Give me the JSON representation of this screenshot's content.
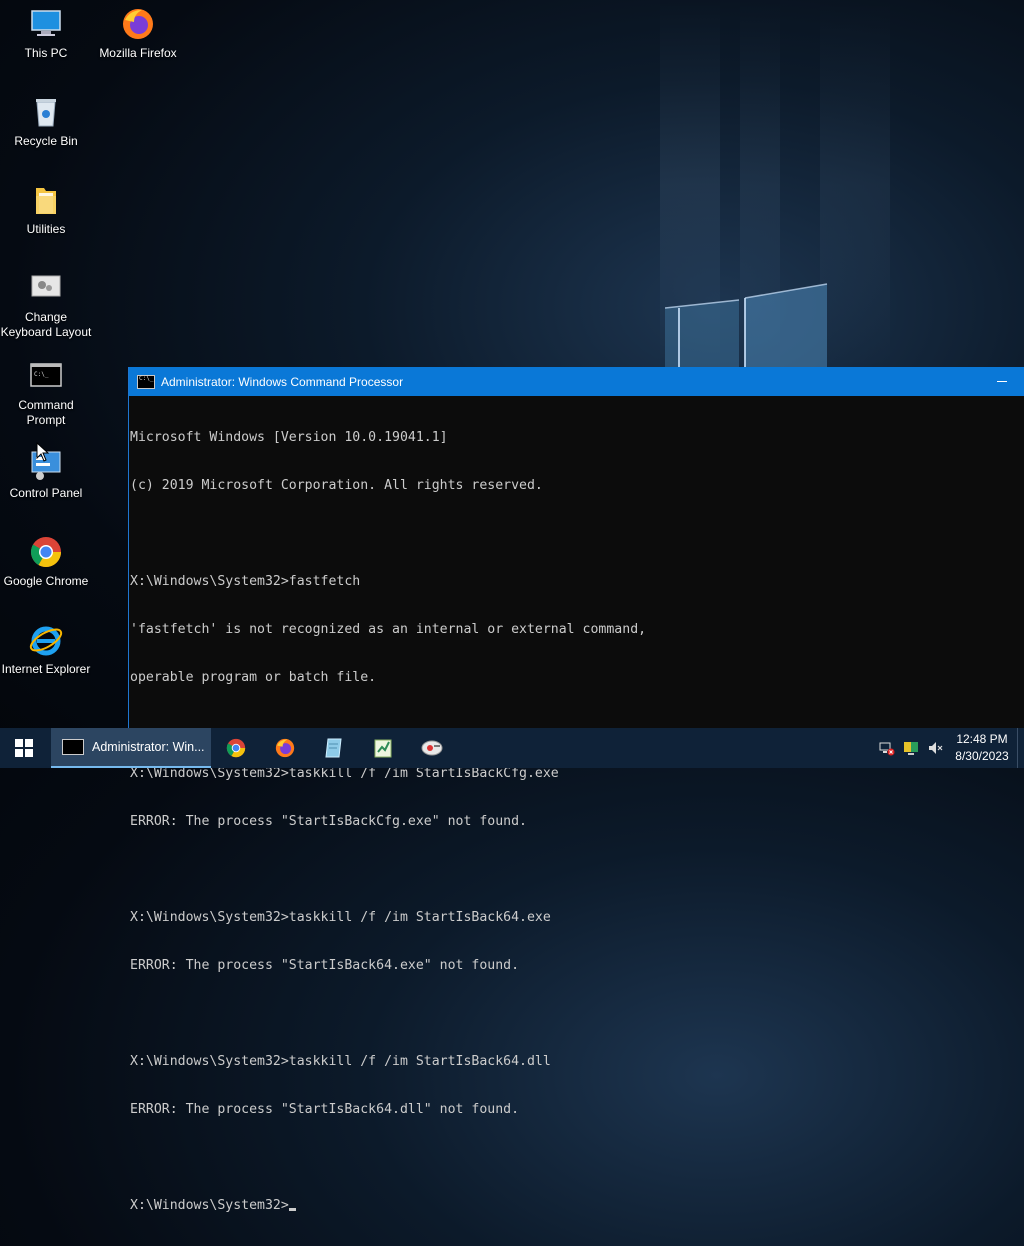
{
  "desktop": {
    "icons": [
      {
        "label": "This PC"
      },
      {
        "label": "Mozilla Firefox"
      },
      {
        "label": "Recycle Bin"
      },
      {
        "label": "Utilities"
      },
      {
        "label": "Change\nKeyboard Layout"
      },
      {
        "label": "Command\nPrompt"
      },
      {
        "label": "Control Panel"
      },
      {
        "label": "Google Chrome"
      },
      {
        "label": "Internet Explorer"
      }
    ]
  },
  "cmd": {
    "title": "Administrator: Windows Command Processor",
    "lines": [
      "Microsoft Windows [Version 10.0.19041.1]",
      "(c) 2019 Microsoft Corporation. All rights reserved.",
      "",
      "X:\\Windows\\System32>fastfetch",
      "'fastfetch' is not recognized as an internal or external command,",
      "operable program or batch file.",
      "",
      "X:\\Windows\\System32>taskkill /f /im StartIsBackCfg.exe",
      "ERROR: The process \"StartIsBackCfg.exe\" not found.",
      "",
      "X:\\Windows\\System32>taskkill /f /im StartIsBack64.exe",
      "ERROR: The process \"StartIsBack64.exe\" not found.",
      "",
      "X:\\Windows\\System32>taskkill /f /im StartIsBack64.dll",
      "ERROR: The process \"StartIsBack64.dll\" not found.",
      ""
    ],
    "prompt": "X:\\Windows\\System32>"
  },
  "taskbar": {
    "active_task_label": "Administrator: Win...",
    "pinned": [
      "chrome-icon",
      "firefox-icon",
      "notepad-icon",
      "paint-icon",
      "tool-icon"
    ],
    "tray_icons": [
      "network-disconnected-icon",
      "display-icon",
      "volume-muted-icon"
    ],
    "time": "12:48 PM",
    "date": "8/30/2023"
  },
  "colors": {
    "title_bar": "#0a78d7",
    "taskbar": "#0f2238",
    "console_bg": "#0c0c0c",
    "console_text": "#cccccc"
  }
}
